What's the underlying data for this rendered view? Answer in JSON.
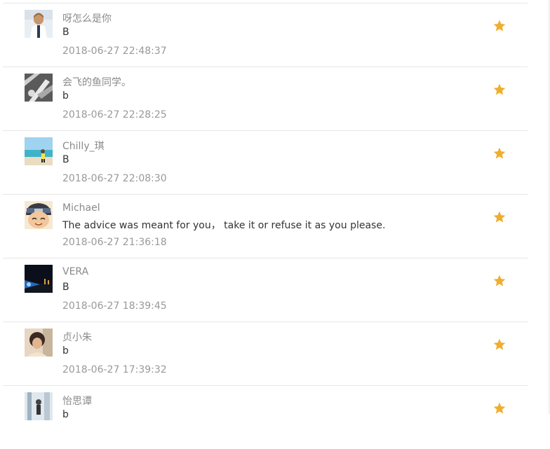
{
  "colors": {
    "star": "#f0ad2e",
    "name": "#8a8a8a",
    "message": "#333333",
    "time": "#999999",
    "divider": "#e6e6e6"
  },
  "comments": [
    {
      "name": "呀怎么是你",
      "message": "B",
      "time": "2018-06-27 22:48:37",
      "avatar": "person-in-white-coat",
      "starred": true
    },
    {
      "name": "会飞的鱼同学。",
      "message": "b",
      "time": "2018-06-27 22:28:25",
      "avatar": "monochrome-abstract",
      "starred": true
    },
    {
      "name": "Chilly_琪",
      "message": "B",
      "time": "2018-06-27 22:08:30",
      "avatar": "beach-scene",
      "starred": true
    },
    {
      "name": "Michael",
      "message": "The advice was meant for you， take it or refuse it as you please.",
      "time": "2018-06-27 21:36:18",
      "avatar": "anime-character",
      "starred": true
    },
    {
      "name": "VERA",
      "message": "B",
      "time": "2018-06-27 18:39:45",
      "avatar": "night-sky-light",
      "starred": true
    },
    {
      "name": "贞小朱",
      "message": "b",
      "time": "2018-06-27 17:39:32",
      "avatar": "child-portrait",
      "starred": true
    },
    {
      "name": "怡思谭",
      "message": "b",
      "time": "",
      "avatar": "light-room",
      "starred": true
    }
  ]
}
